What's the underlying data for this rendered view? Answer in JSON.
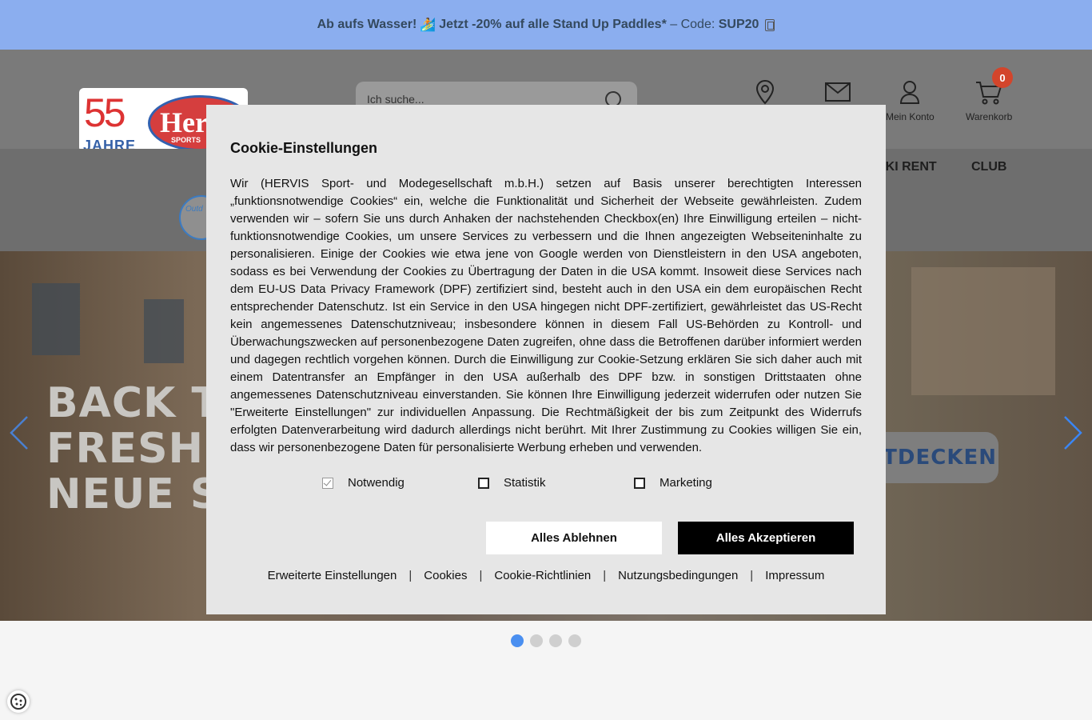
{
  "promo": {
    "part1": "Ab aufs Wasser!",
    "emoji": "🏄",
    "part2": "Jetzt -20% auf alle Stand Up Paddles*",
    "part3": " – Code: ",
    "code": "SUP20"
  },
  "logo": {
    "years": "55",
    "jahre": "JAHRE",
    "brand": "Herv",
    "sub": "SPORTS"
  },
  "search": {
    "placeholder": "Ich suche..."
  },
  "header_icons": {
    "account_label": "Mein Konto",
    "cart_label": "Warenkorb",
    "cart_count": "0"
  },
  "nav": {
    "ski": "SKI RENT",
    "club": "CLUB",
    "outdoor": "Outd"
  },
  "hero": {
    "line1": "BACK TO",
    "line2": "FRESH",
    "line3": "NEUE S",
    "cta": "TDECKEN"
  },
  "slider": {
    "count": 4,
    "active": 0
  },
  "cookie_modal": {
    "title": "Cookie-Einstellungen",
    "body": "Wir (HERVIS Sport- und Modegesellschaft m.b.H.) setzen auf Basis unserer berechtigten Interessen „funktionsnotwendige Cookies“ ein, welche die Funktionalität und Sicherheit der Webseite gewährleisten. Zudem verwenden wir – sofern Sie uns durch Anhaken der nachstehenden Checkbox(en) Ihre Einwilligung erteilen – nicht-funktionsnotwendige Cookies, um unsere Services zu verbessern und die Ihnen angezeigten Webseiteninhalte zu personalisieren. Einige der Cookies wie etwa jene von Google werden von Dienstleistern in den USA angeboten, sodass es bei Verwendung der Cookies zu Übertragung der Daten in die USA kommt. Insoweit diese Services nach dem EU-US Data Privacy Framework (DPF) zertifiziert sind, besteht auch in den USA ein dem europäischen Recht entsprechender Datenschutz. Ist ein Service in den USA hingegen nicht DPF-zertifiziert, gewährleistet das US-Recht kein angemessenes Datenschutzniveau; insbesondere können in diesem Fall US-Behörden zu Kontroll- und Überwachungszwecken auf personenbezogene Daten zugreifen, ohne dass die Betroffenen darüber informiert werden und dagegen rechtlich vorgehen können. Durch die Einwilligung zur Cookie-Setzung erklären Sie sich daher auch mit einem Datentransfer an Empfänger in den USA außerhalb des DPF bzw. in sonstigen Drittstaaten ohne angemessenes Datenschutzniveau einverstanden. Sie können Ihre Einwilligung jederzeit widerrufen oder nutzen Sie \"Erweiterte Einstellungen\" zur individuellen Anpassung. Die Rechtmäßigkeit der bis zum Zeitpunkt des Widerrufs erfolgten Datenverarbeitung wird dadurch allerdings nicht berührt. Mit Ihrer Zustimmung zu Cookies willigen Sie ein, dass wir personenbezogene Daten für personalisierte Werbung erheben und verwenden.",
    "checkboxes": [
      {
        "label": "Notwendig",
        "checked": true
      },
      {
        "label": "Statistik",
        "checked": false
      },
      {
        "label": "Marketing",
        "checked": false
      }
    ],
    "reject_label": "Alles Ablehnen",
    "accept_label": "Alles Akzeptieren",
    "links": [
      "Erweiterte Einstellungen",
      "Cookies",
      "Cookie-Richtlinien",
      "Nutzungsbedingungen",
      "Impressum"
    ],
    "separator": "|"
  }
}
